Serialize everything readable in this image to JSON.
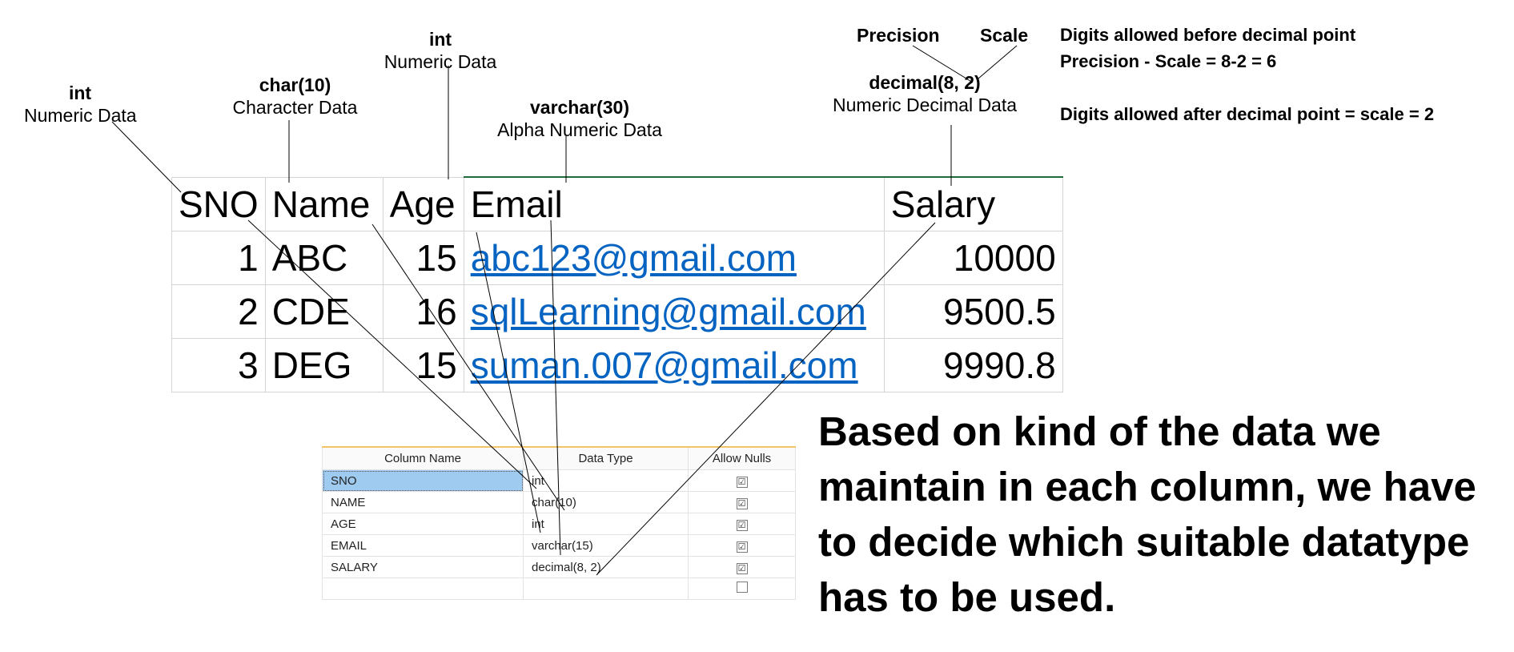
{
  "annotations": {
    "sno": {
      "datatype": "int",
      "description": "Numeric Data"
    },
    "name": {
      "datatype": "char(10)",
      "description": "Character Data"
    },
    "age": {
      "datatype": "int",
      "description": "Numeric Data"
    },
    "email": {
      "datatype": "varchar(30)",
      "description": "Alpha Numeric Data"
    },
    "salary": {
      "datatype": "decimal(8, 2)",
      "description": "Numeric Decimal Data"
    }
  },
  "precision_label": "Precision",
  "scale_label": "Scale",
  "notes": {
    "line1": "Digits allowed before decimal point",
    "line2": "Precision - Scale = 8-2 = 6",
    "line3": "Digits allowed after decimal point = scale = 2"
  },
  "sheet": {
    "headers": [
      "SNO",
      "Name",
      "Age",
      "Email",
      "Salary"
    ],
    "rows": [
      [
        "1",
        "ABC",
        "15",
        "abc123@gmail.com",
        "10000"
      ],
      [
        "2",
        "CDE",
        "16",
        "sqlLearning@gmail.com",
        "9500.5"
      ],
      [
        "3",
        "DEG",
        "15",
        "suman.007@gmail.com",
        "9990.8"
      ]
    ]
  },
  "designer": {
    "headers": [
      "Column Name",
      "Data Type",
      "Allow Nulls"
    ],
    "rows": [
      {
        "name": "SNO",
        "type": "int",
        "allow_nulls": "☑"
      },
      {
        "name": "NAME",
        "type": "char(10)",
        "allow_nulls": "☑"
      },
      {
        "name": "AGE",
        "type": "int",
        "allow_nulls": "☑"
      },
      {
        "name": "EMAIL",
        "type": "varchar(15)",
        "allow_nulls": "☑"
      },
      {
        "name": "SALARY",
        "type": "decimal(8, 2)",
        "allow_nulls": "☑"
      },
      {
        "name": "",
        "type": "",
        "allow_nulls": ""
      }
    ]
  },
  "summary": {
    "line1": "Based on kind of the data we",
    "line2": "maintain in each column, we have",
    "line3": "to decide which suitable datatype",
    "line4": "has to be used."
  }
}
